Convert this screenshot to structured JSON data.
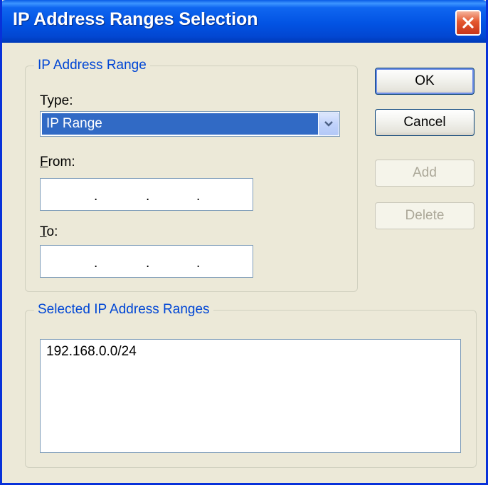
{
  "window": {
    "title": "IP Address Ranges Selection",
    "close_icon": "close-icon"
  },
  "colors": {
    "title_bar": "#0253e3",
    "group_label": "#0046d5",
    "selection": "#316ac5",
    "dialog_bg": "#ece9d8"
  },
  "range_group": {
    "legend": "IP Address Range",
    "type_label": "Type:",
    "type_value": "IP Range",
    "from_label_mnemonic": "F",
    "from_label_rest": "rom:",
    "from_value": [
      "",
      "",
      "",
      ""
    ],
    "to_label_mnemonic": "T",
    "to_label_rest": "o:",
    "to_value": [
      "",
      "",
      "",
      ""
    ],
    "ip_separator": "."
  },
  "buttons": {
    "ok": "OK",
    "cancel": "Cancel",
    "add": "Add",
    "delete": "Delete"
  },
  "selected_group": {
    "legend": "Selected IP Address Ranges",
    "items": [
      "192.168.0.0/24"
    ]
  }
}
